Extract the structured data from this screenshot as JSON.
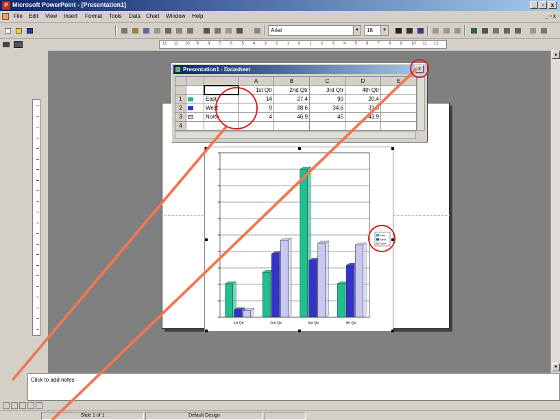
{
  "window": {
    "title": "Microsoft PowerPoint - [Presentation1]",
    "app_icon": "powerpoint-icon"
  },
  "menu": {
    "items": [
      "File",
      "Edit",
      "View",
      "Insert",
      "Format",
      "Tools",
      "Data",
      "Chart",
      "Window",
      "Help"
    ]
  },
  "toolbar": {
    "font": "Arial",
    "font_size": "18"
  },
  "ruler": {
    "h_labels": [
      "12",
      "11",
      "10",
      "9",
      "8",
      "7",
      "6",
      "5",
      "4",
      "3",
      "2",
      "1",
      "0",
      "1",
      "2",
      "3",
      "4",
      "5",
      "6",
      "7",
      "8",
      "9",
      "10",
      "11",
      "12"
    ]
  },
  "datasheet": {
    "title": "Presentation1 - Datasheet",
    "col_letters": [
      "A",
      "B",
      "C",
      "D",
      "E"
    ],
    "headers": [
      "1st Qtr",
      "2nd Qtr",
      "3rd Qtr",
      "4th Qtr"
    ],
    "rows": [
      {
        "num": "1",
        "label": "East",
        "values": [
          "14",
          "27.4",
          "90",
          "20.4"
        ]
      },
      {
        "num": "2",
        "label": "West",
        "values": [
          "9",
          "38.6",
          "34.6",
          "31.6"
        ]
      },
      {
        "num": "3",
        "label": "North",
        "values": [
          "4",
          "46.9",
          "45",
          "43.9"
        ]
      },
      {
        "num": "4",
        "label": "",
        "values": [
          "",
          "",
          "",
          ""
        ]
      }
    ]
  },
  "chart_data": {
    "type": "bar",
    "categories": [
      "1st Qtr",
      "2nd Qtr",
      "3rd Qtr",
      "4th Qtr"
    ],
    "series": [
      {
        "name": "East",
        "values": [
          20.4,
          27.4,
          90,
          20.4
        ],
        "color": "#1fbf8f"
      },
      {
        "name": "West",
        "values": [
          4.6,
          38.6,
          34.6,
          31.6
        ],
        "color": "#3333cc"
      },
      {
        "name": "North",
        "values": [
          4,
          46.9,
          45,
          43.9
        ],
        "color": "#c8c8f0"
      }
    ],
    "ylim": [
      0,
      100
    ],
    "y_ticks": [
      0,
      10,
      20,
      30,
      40,
      50,
      60,
      70,
      80,
      90,
      100
    ],
    "grid": true,
    "legend": "right"
  },
  "notes": {
    "placeholder": "Click to add notes"
  },
  "status": {
    "slide": "Slide 1 of 1",
    "design": "Default Design"
  },
  "colors": {
    "annotation": "#f07850",
    "highlight_circle": "#e01818"
  }
}
